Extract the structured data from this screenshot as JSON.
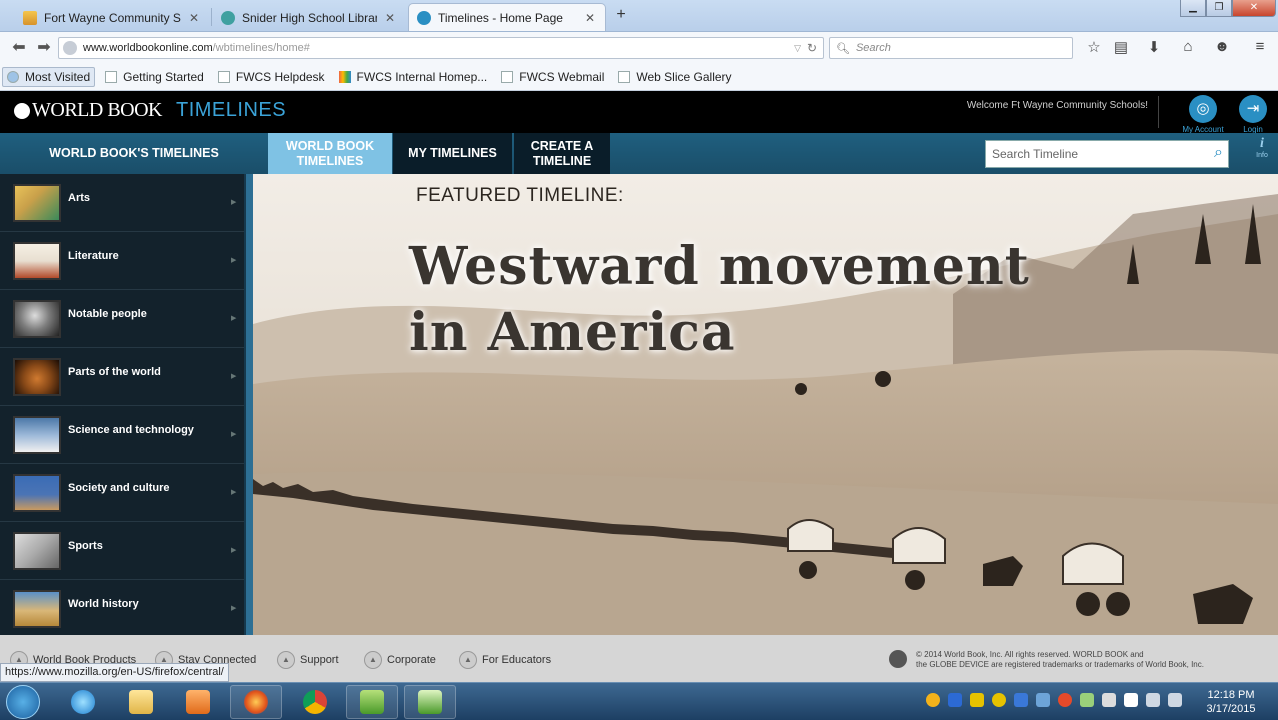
{
  "browser": {
    "tabs": [
      {
        "title": "Fort Wayne Community Sc...",
        "active": false
      },
      {
        "title": "Snider High School Library ...",
        "active": false
      },
      {
        "title": "Timelines - Home Page",
        "active": true
      }
    ],
    "url_host": "www.worldbookonline.com",
    "url_path": "/wbtimelines/home#",
    "search_placeholder": "Search",
    "bookmarks": [
      "Most Visited",
      "Getting Started",
      "FWCS Helpdesk",
      "FWCS Internal Homep...",
      "FWCS Webmail",
      "Web Slice Gallery"
    ],
    "status_url": "https://www.mozilla.org/en-US/firefox/central/"
  },
  "site": {
    "brand": "WORLD BOOK",
    "product": "TIMELINES",
    "welcome": "Welcome Ft Wayne Community Schools!",
    "my_account": "My Account",
    "login": "Login",
    "nav_main": "WORLD BOOK'S TIMELINES",
    "nav_tabs": [
      {
        "line1": "WORLD BOOK",
        "line2": "TIMELINES",
        "selected": true
      },
      {
        "line1": "MY TIMELINES",
        "line2": "",
        "selected": false
      },
      {
        "line1": "CREATE A",
        "line2": "TIMELINE",
        "selected": false
      }
    ],
    "search_placeholder": "Search Timeline",
    "info": "Info"
  },
  "sidebar": {
    "items": [
      {
        "label": "Arts",
        "thumb_color": "#c9a04a"
      },
      {
        "label": "Literature",
        "thumb_color": "#e8dfd0"
      },
      {
        "label": "Notable people",
        "thumb_color": "#7d7d7d"
      },
      {
        "label": "Parts of the world",
        "thumb_color": "#8a4a18"
      },
      {
        "label": "Science and technology",
        "thumb_color": "#6a8fb8"
      },
      {
        "label": "Society and culture",
        "thumb_color": "#4b74b5"
      },
      {
        "label": "Sports",
        "thumb_color": "#aaaaaa"
      },
      {
        "label": "World history",
        "thumb_color": "#b6883a"
      }
    ]
  },
  "featured": {
    "label": "FEATURED TIMELINE:",
    "title_line1": "Westward movement",
    "title_line2": "in America"
  },
  "footer": {
    "links": [
      "World Book Products",
      "Stay Connected",
      "Support",
      "Corporate",
      "For Educators"
    ],
    "copyright_line1": "© 2014 World Book, Inc. All rights reserved. WORLD BOOK and",
    "copyright_line2": "the GLOBE DEVICE are registered trademarks or trademarks of World Book, Inc."
  },
  "taskbar": {
    "time": "12:18 PM",
    "date": "3/17/2015"
  }
}
